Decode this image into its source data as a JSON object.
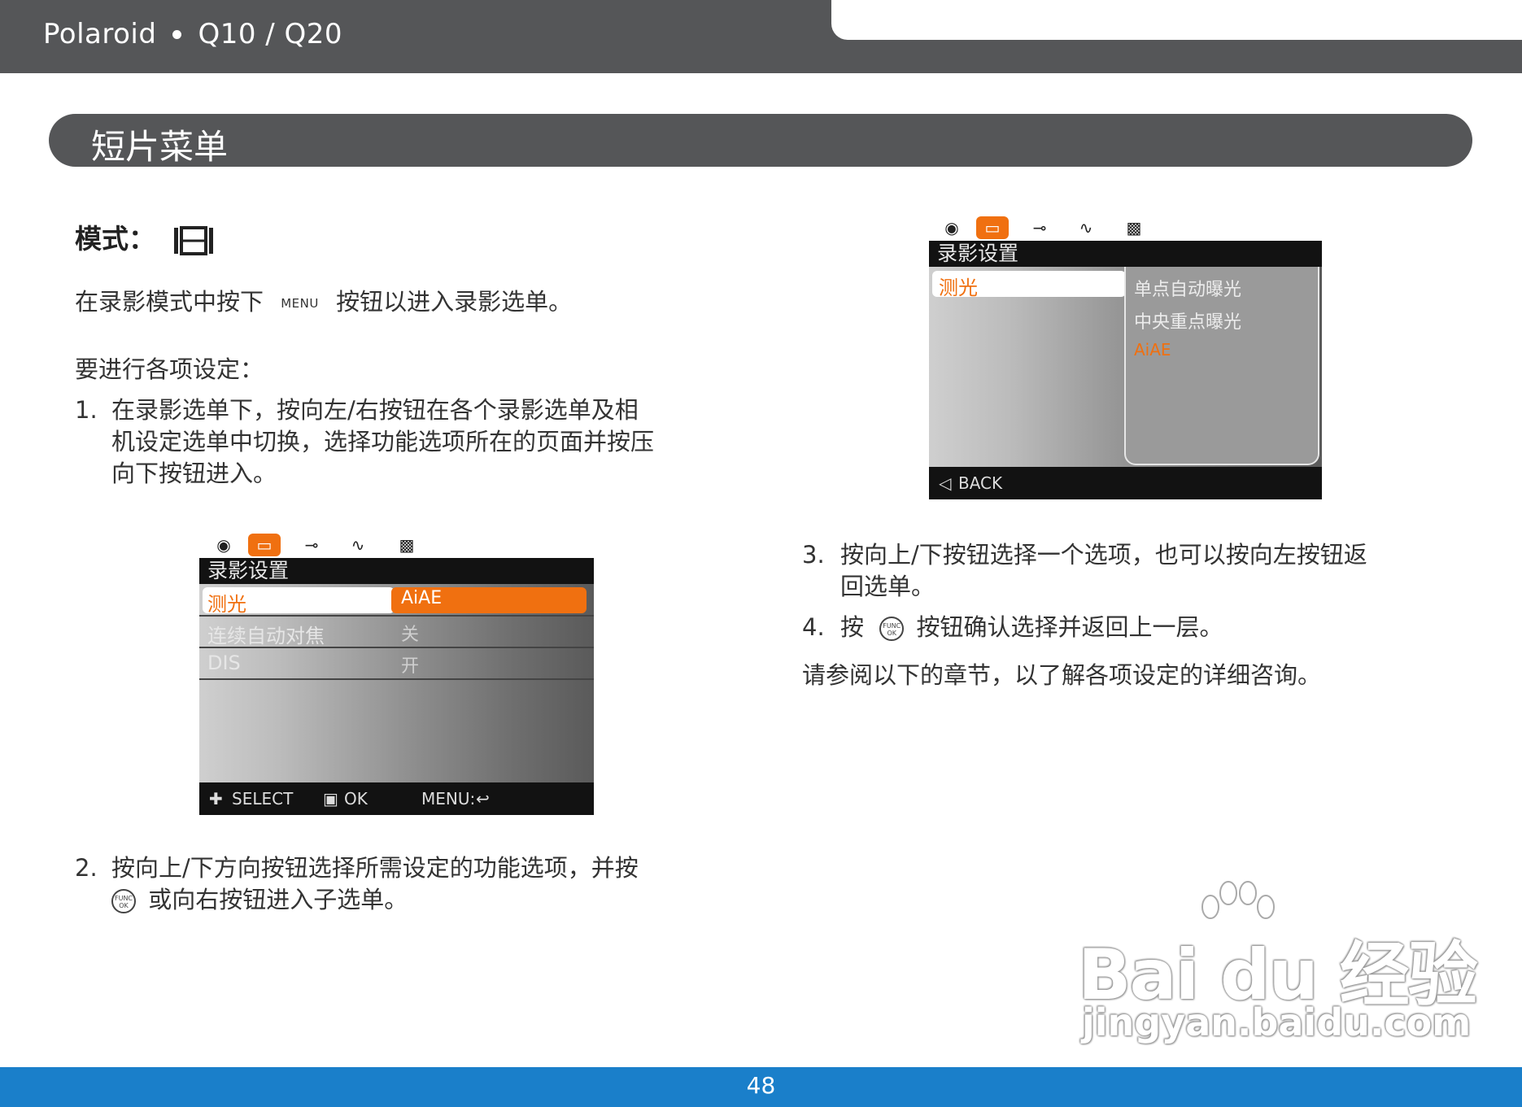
{
  "header": {
    "brand": "Polaroid",
    "model": "Q10 / Q20"
  },
  "section": {
    "title": "短片菜单"
  },
  "intro": {
    "mode_label": "模式：",
    "line1_pre": "在录影模式中按下",
    "menu_word": "MENU",
    "line1_post": "按钮以进入录影选单。",
    "settings_heading": "要进行各项设定："
  },
  "steps": {
    "s1_num": "1.",
    "s1_line1": "在录影选单下，按向左/右按钮在各个录影选单及相",
    "s1_line2": "机设定选单中切换，选择功能选项所在的页面并按压",
    "s1_line3": "向下按钮进入。",
    "s2_num": "2.",
    "s2_line1": "按向上/下方向按钮选择所需设定的功能选项，并按",
    "s2_line2": "或向右按钮进入子选单。",
    "s3_num": "3.",
    "s3_line1": "按向上/下按钮选择一个选项，也可以按向左按钮返",
    "s3_line2": "回选单。",
    "s4_num": "4.",
    "s4_pre": "按",
    "s4_post": "按钮确认选择并返回上一层。",
    "closing": "请参阅以下的章节，以了解各项设定的详细咨询。",
    "func_top": "FUNC",
    "func_bottom": "OK"
  },
  "screen1": {
    "header": "录影设置",
    "rows": [
      {
        "label": "测光",
        "value": "AiAE"
      },
      {
        "label": "连续自动对焦",
        "value": "关"
      },
      {
        "label": "DIS",
        "value": "开"
      }
    ],
    "footer_select": "SELECT",
    "footer_ok": "OK",
    "footer_menu": "MENU:"
  },
  "screen2": {
    "header": "录影设置",
    "row_label": "测光",
    "options": [
      "单点自动曝光",
      "中央重点曝光",
      "AiAE"
    ],
    "footer_back": "BACK"
  },
  "page": {
    "number": "48"
  },
  "watermark": {
    "logo": "Bai du 经验",
    "url": "jingyan.baidu.com"
  },
  "colors": {
    "header_gray": "#555658",
    "accent_orange": "#f07010",
    "footer_blue": "#1a7fca"
  }
}
